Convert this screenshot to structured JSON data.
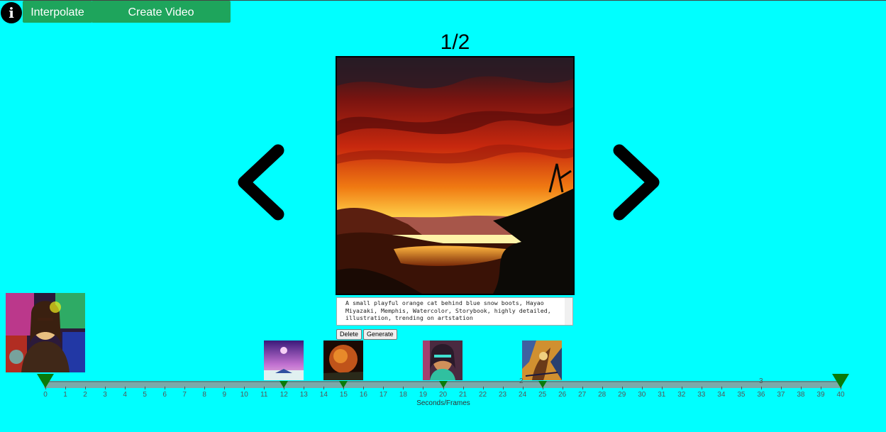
{
  "toolbar": {
    "info_icon": "info-icon",
    "interpolate_label": "Interpolate",
    "create_video_label": "Create Video",
    "button_color": "#1ea55c"
  },
  "viewer": {
    "counter": "1/2",
    "prev_icon": "chevron-left-icon",
    "next_icon": "chevron-right-icon",
    "prompt_text": "A small playful orange cat behind blue snow boots, Hayao Miyazaki, Memphis, Watercolor, Storybook, highly detailed, illustration, trending on artstation",
    "delete_label": "Delete",
    "generate_label": "Generate"
  },
  "timeline": {
    "ticks": [
      "0",
      "1",
      "2",
      "3",
      "4",
      "5",
      "6",
      "7",
      "8",
      "9",
      "10",
      "11",
      "12",
      "13",
      "14",
      "15",
      "16",
      "17",
      "18",
      "19",
      "20",
      "21",
      "22",
      "23",
      "24",
      "25",
      "26",
      "27",
      "28",
      "29",
      "30",
      "31",
      "32",
      "33",
      "34",
      "35",
      "36",
      "37",
      "38",
      "39",
      "40"
    ],
    "axis_title": "Seconds/Frames",
    "keyframes": [
      12,
      15,
      20,
      25
    ],
    "end_markers": [
      0,
      40
    ],
    "floating_labels": [
      "2",
      "3"
    ],
    "marker_color": "#0a7a0a",
    "background": "#00ffff"
  }
}
